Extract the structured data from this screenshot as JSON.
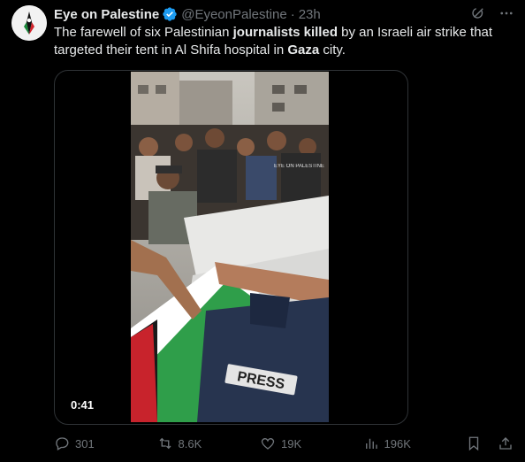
{
  "tweet": {
    "display_name": "Eye on Palestine",
    "handle": "@EyeonPalestine",
    "separator": "·",
    "time": "23h",
    "text_parts": {
      "p1": "The farewell of six Palestinian ",
      "p2": "journalists killed",
      "p3": " by an Israeli air strike that targeted their tent in Al Shifa hospital in ",
      "p4": "Gaza",
      "p5": " city."
    },
    "video": {
      "duration": "0:41",
      "overlay_text": "EYE ON PALESTINE",
      "vest_label": "PRESS"
    },
    "actions": {
      "replies": "301",
      "reposts": "8.6K",
      "likes": "19K",
      "views": "196K"
    }
  },
  "colors": {
    "background": "#000000",
    "text": "#e7e9ea",
    "secondary": "#71767b",
    "verified_blue": "#1d9bf0",
    "border": "#2f3336"
  }
}
